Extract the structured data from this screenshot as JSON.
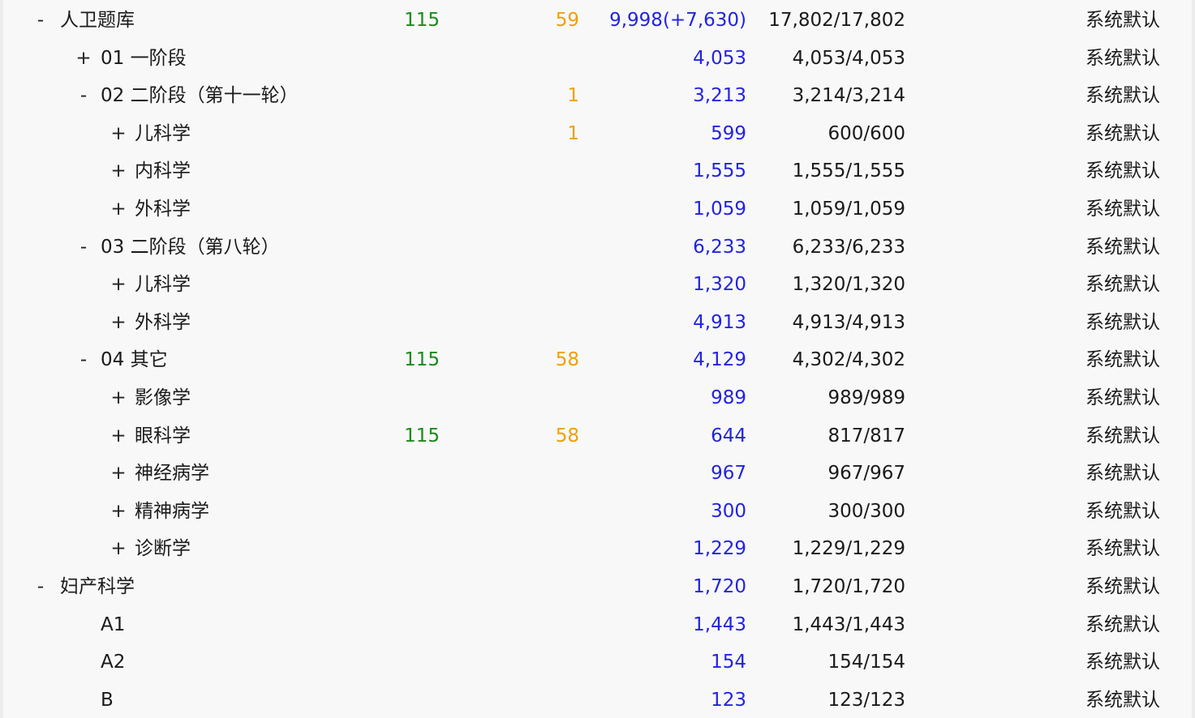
{
  "rows": [
    {
      "toggle": "-",
      "name": "人卫题库",
      "c1": "115",
      "c2": "59",
      "c3": "9,998(+7,630)",
      "c4": "17,802/17,802",
      "c5": "系统默认"
    },
    {
      "toggle": "+",
      "name": "01 一阶段",
      "c1": "",
      "c2": "",
      "c3": "4,053",
      "c4": "4,053/4,053",
      "c5": "系统默认"
    },
    {
      "toggle": "-",
      "name": "02 二阶段（第十一轮）",
      "c1": "",
      "c2": "1",
      "c3": "3,213",
      "c4": "3,214/3,214",
      "c5": "系统默认"
    },
    {
      "toggle": "+",
      "name": "儿科学",
      "c1": "",
      "c2": "1",
      "c3": "599",
      "c4": "600/600",
      "c5": "系统默认"
    },
    {
      "toggle": "+",
      "name": "内科学",
      "c1": "",
      "c2": "",
      "c3": "1,555",
      "c4": "1,555/1,555",
      "c5": "系统默认"
    },
    {
      "toggle": "+",
      "name": "外科学",
      "c1": "",
      "c2": "",
      "c3": "1,059",
      "c4": "1,059/1,059",
      "c5": "系统默认"
    },
    {
      "toggle": "-",
      "name": "03 二阶段（第八轮）",
      "c1": "",
      "c2": "",
      "c3": "6,233",
      "c4": "6,233/6,233",
      "c5": "系统默认"
    },
    {
      "toggle": "+",
      "name": "儿科学",
      "c1": "",
      "c2": "",
      "c3": "1,320",
      "c4": "1,320/1,320",
      "c5": "系统默认"
    },
    {
      "toggle": "+",
      "name": "外科学",
      "c1": "",
      "c2": "",
      "c3": "4,913",
      "c4": "4,913/4,913",
      "c5": "系统默认"
    },
    {
      "toggle": "-",
      "name": "04 其它",
      "c1": "115",
      "c2": "58",
      "c3": "4,129",
      "c4": "4,302/4,302",
      "c5": "系统默认"
    },
    {
      "toggle": "+",
      "name": "影像学",
      "c1": "",
      "c2": "",
      "c3": "989",
      "c4": "989/989",
      "c5": "系统默认"
    },
    {
      "toggle": "+",
      "name": "眼科学",
      "c1": "115",
      "c2": "58",
      "c3": "644",
      "c4": "817/817",
      "c5": "系统默认"
    },
    {
      "toggle": "+",
      "name": "神经病学",
      "c1": "",
      "c2": "",
      "c3": "967",
      "c4": "967/967",
      "c5": "系统默认"
    },
    {
      "toggle": "+",
      "name": "精神病学",
      "c1": "",
      "c2": "",
      "c3": "300",
      "c4": "300/300",
      "c5": "系统默认"
    },
    {
      "toggle": "+",
      "name": "诊断学",
      "c1": "",
      "c2": "",
      "c3": "1,229",
      "c4": "1,229/1,229",
      "c5": "系统默认"
    },
    {
      "toggle": "-",
      "name": "妇产科学",
      "c1": "",
      "c2": "",
      "c3": "1,720",
      "c4": "1,720/1,720",
      "c5": "系统默认"
    },
    {
      "toggle": "",
      "name": "A1",
      "c1": "",
      "c2": "",
      "c3": "1,443",
      "c4": "1,443/1,443",
      "c5": "系统默认"
    },
    {
      "toggle": "",
      "name": "A2",
      "c1": "",
      "c2": "",
      "c3": "154",
      "c4": "154/154",
      "c5": "系统默认"
    },
    {
      "toggle": "",
      "name": "B",
      "c1": "",
      "c2": "",
      "c3": "123",
      "c4": "123/123",
      "c5": "系统默认"
    }
  ]
}
